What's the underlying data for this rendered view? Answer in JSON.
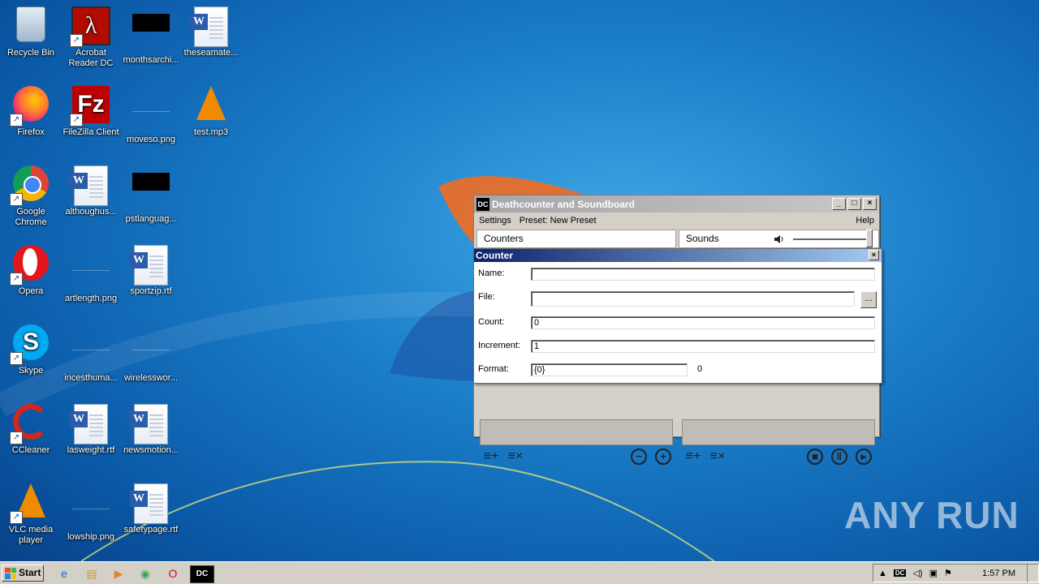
{
  "desktop": {
    "icons": [
      {
        "label": "Recycle Bin",
        "kind": "recycle-bin"
      },
      {
        "label": "Acrobat Reader DC",
        "kind": "acrobat"
      },
      {
        "label": "monthsarchi...",
        "kind": "black-image"
      },
      {
        "label": "theseamate...",
        "kind": "word-doc"
      },
      {
        "label": "Firefox",
        "kind": "firefox"
      },
      {
        "label": "FileZilla Client",
        "kind": "filezilla"
      },
      {
        "label": "moveso.png",
        "kind": "blank-image"
      },
      {
        "label": "test.mp3",
        "kind": "vlc-file"
      },
      {
        "label": "Google Chrome",
        "kind": "chrome"
      },
      {
        "label": "althoughus...",
        "kind": "word-doc"
      },
      {
        "label": "pstlanguag...",
        "kind": "black-image"
      },
      {
        "label": "Opera",
        "kind": "opera"
      },
      {
        "label": "artlength.png",
        "kind": "blank-image"
      },
      {
        "label": "sportzip.rtf",
        "kind": "word-doc"
      },
      {
        "label": "Skype",
        "kind": "skype"
      },
      {
        "label": "incesthuma...",
        "kind": "blank-image"
      },
      {
        "label": "wirelesswor...",
        "kind": "blank-image"
      },
      {
        "label": "CCleaner",
        "kind": "ccleaner"
      },
      {
        "label": "lasweight.rtf",
        "kind": "word-doc"
      },
      {
        "label": "newsmotion...",
        "kind": "word-doc"
      },
      {
        "label": "VLC media player",
        "kind": "vlc"
      },
      {
        "label": "lowship.png",
        "kind": "blank-image"
      },
      {
        "label": "safetypage.rtf",
        "kind": "word-doc"
      }
    ]
  },
  "app_window": {
    "title": "Deathcounter and Soundboard",
    "icon_text": "DC",
    "menu": {
      "settings": "Settings",
      "preset": "Preset: New Preset",
      "help": "Help"
    },
    "counters_label": "Counters",
    "sounds_label": "Sounds",
    "volume_level": 1.0
  },
  "counter_dialog": {
    "title": "Counter",
    "name_label": "Name:",
    "name_value": "",
    "file_label": "File:",
    "file_value": "",
    "browse_label": "...",
    "count_label": "Count:",
    "count_value": "0",
    "increment_label": "Increment:",
    "increment_value": "1",
    "format_label": "Format:",
    "format_value": "{0}",
    "preview_value": "0"
  },
  "taskbar": {
    "start_label": "Start",
    "clock": "1:57 PM"
  },
  "watermark": "ANY RUN",
  "colors": {
    "desktop_blue": "#1a7cc7",
    "dialog_title": "#0a246a",
    "window_face": "#d4d0c8"
  }
}
